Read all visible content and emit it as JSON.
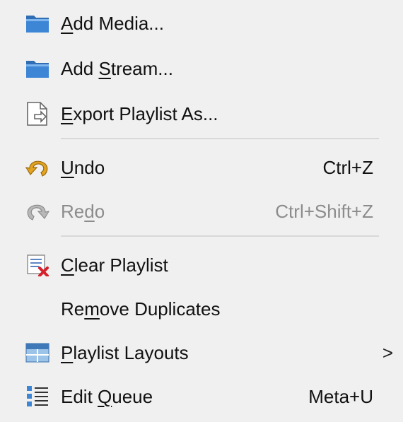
{
  "menu": {
    "items": [
      {
        "pre": "",
        "u": "A",
        "post": "dd Media...",
        "shortcut": "",
        "icon": "folder-icon"
      },
      {
        "pre": "Add ",
        "u": "S",
        "post": "tream...",
        "shortcut": "",
        "icon": "folder-icon"
      },
      {
        "pre": "",
        "u": "E",
        "post": "xport Playlist As...",
        "shortcut": "",
        "icon": "export-document-icon"
      },
      {
        "pre": "",
        "u": "U",
        "post": "ndo",
        "shortcut": "Ctrl+Z",
        "icon": "undo-icon"
      },
      {
        "pre": "Re",
        "u": "d",
        "post": "o",
        "shortcut": "Ctrl+Shift+Z",
        "icon": "redo-icon"
      },
      {
        "pre": "",
        "u": "C",
        "post": "lear Playlist",
        "shortcut": "",
        "icon": "clear-playlist-icon"
      },
      {
        "pre": "Re",
        "u": "m",
        "post": "ove Duplicates",
        "shortcut": "",
        "icon": ""
      },
      {
        "pre": "",
        "u": "P",
        "post": "laylist Layouts",
        "shortcut": "",
        "icon": "layout-icon",
        "submenu_arrow": ">"
      },
      {
        "pre": "Edit ",
        "u": "Q",
        "post": "ueue",
        "shortcut": "Meta+U",
        "icon": "queue-list-icon"
      }
    ]
  },
  "colors": {
    "background": "#f0f0f0",
    "text": "#111111",
    "disabled_text": "#8c8c8c",
    "separator": "#d8d8d8",
    "folder_blue": "#2f6db5",
    "undo_orange": "#e2a321",
    "clear_red": "#d6202a"
  }
}
